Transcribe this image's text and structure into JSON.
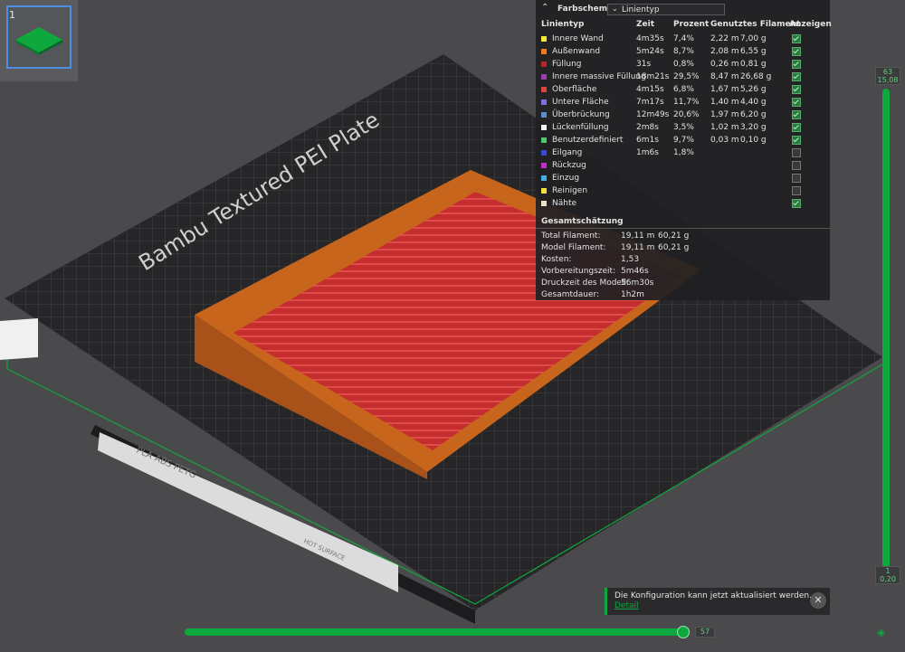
{
  "plate": {
    "number": "1"
  },
  "bed": {
    "title": "Bambu Textured PEI Plate",
    "filament_text": "PLA ABS PETG",
    "hot_surface_text": "HOT SURFACE"
  },
  "legend": {
    "title": "Farbschema",
    "scheme_value": "Linientyp",
    "headers": {
      "type": "Linientyp",
      "time": "Zeit",
      "percent": "Prozent",
      "used": "Genutztes Filament",
      "show": "Anzeigen"
    },
    "rows": [
      {
        "name": "Innere Wand",
        "color": "#f2e83a",
        "time": "4m35s",
        "percent": "7,4%",
        "length": "2,22 m",
        "weight": "7,00 g",
        "shown": true
      },
      {
        "name": "Außenwand",
        "color": "#f07a1e",
        "time": "5m24s",
        "percent": "8,7%",
        "length": "2,08 m",
        "weight": "6,55 g",
        "shown": true
      },
      {
        "name": "Füllung",
        "color": "#b5262c",
        "time": "31s",
        "percent": "0,8%",
        "length": "0,26 m",
        "weight": "0,81 g",
        "shown": true
      },
      {
        "name": "Innere massive Füllung",
        "color": "#9b3ea8",
        "time": "18m21s",
        "percent": "29,5%",
        "length": "8,47 m",
        "weight": "26,68 g",
        "shown": true
      },
      {
        "name": "Oberfläche",
        "color": "#e0433f",
        "time": "4m15s",
        "percent": "6,8%",
        "length": "1,67 m",
        "weight": "5,26 g",
        "shown": true
      },
      {
        "name": "Untere Fläche",
        "color": "#7b70e0",
        "time": "7m17s",
        "percent": "11,7%",
        "length": "1,40 m",
        "weight": "4,40 g",
        "shown": true
      },
      {
        "name": "Überbrückung",
        "color": "#5b8fc8",
        "time": "12m49s",
        "percent": "20,6%",
        "length": "1,97 m",
        "weight": "6,20 g",
        "shown": true
      },
      {
        "name": "Lückenfüllung",
        "color": "#f5f5f5",
        "time": "2m8s",
        "percent": "3,5%",
        "length": "1,02 m",
        "weight": "3,20 g",
        "shown": true
      },
      {
        "name": "Benutzerdefiniert",
        "color": "#4fc870",
        "time": "6m1s",
        "percent": "9,7%",
        "length": "0,03 m",
        "weight": "0,10 g",
        "shown": true
      },
      {
        "name": "Eilgang",
        "color": "#3a4ad0",
        "time": "1m6s",
        "percent": "1,8%",
        "length": "",
        "weight": "",
        "shown": false
      },
      {
        "name": "Rückzug",
        "color": "#c030c8",
        "time": "",
        "percent": "",
        "length": "",
        "weight": "",
        "shown": false
      },
      {
        "name": "Einzug",
        "color": "#40b0e0",
        "time": "",
        "percent": "",
        "length": "",
        "weight": "",
        "shown": false
      },
      {
        "name": "Reinigen",
        "color": "#f0e040",
        "time": "",
        "percent": "",
        "length": "",
        "weight": "",
        "shown": false
      },
      {
        "name": "Nähte",
        "color": "#e8e0c8",
        "time": "",
        "percent": "",
        "length": "",
        "weight": "",
        "shown": true
      }
    ],
    "summary_title": "Gesamtschätzung",
    "summary": [
      {
        "label": "Total Filament:",
        "v1": "19,11 m",
        "v2": "60,21 g"
      },
      {
        "label": "Model Filament:",
        "v1": "19,11 m",
        "v2": "60,21 g"
      },
      {
        "label": "Kosten:",
        "v1": "1,53",
        "v2": ""
      },
      {
        "label": "Vorbereitungszeit:",
        "v1": "5m46s",
        "v2": ""
      },
      {
        "label": "Druckzeit des Modell:",
        "v1": "56m30s",
        "v2": ""
      },
      {
        "label": "Gesamtdauer:",
        "v1": "1h2m",
        "v2": ""
      }
    ]
  },
  "vertical_slider": {
    "top_layer": "63",
    "top_height": "15,08",
    "bottom_layer": "1",
    "bottom_height": "0,20"
  },
  "horizontal_slider": {
    "value": "57"
  },
  "notification": {
    "message": "Die Konfiguration kann jetzt aktualisiert werden.",
    "link": "Detail"
  },
  "colors": {
    "accent": "#0fa83e",
    "model_top": "#c9302f",
    "model_wall": "#d8701f"
  }
}
